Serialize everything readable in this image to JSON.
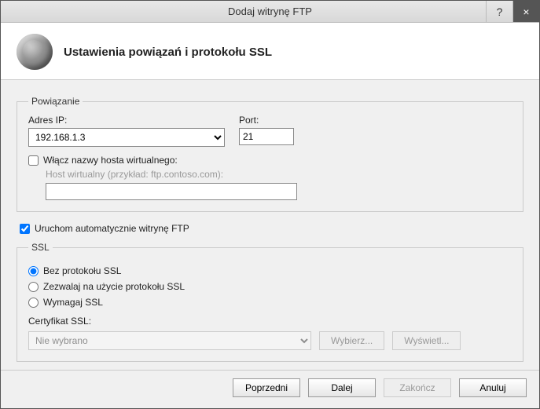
{
  "titlebar": {
    "title": "Dodaj witrynę FTP",
    "help": "?",
    "close": "×"
  },
  "header": {
    "title": "Ustawienia powiązań i protokołu SSL"
  },
  "binding": {
    "legend": "Powiązanie",
    "ip_label": "Adres IP:",
    "ip_value": "192.168.1.3",
    "port_label": "Port:",
    "port_value": "21",
    "vhost_check": "Włącz nazwy hosta wirtualnego:",
    "vhost_label": "Host wirtualny (przykład: ftp.contoso.com):",
    "vhost_value": ""
  },
  "autostart": {
    "label": "Uruchom automatycznie witrynę FTP"
  },
  "ssl": {
    "legend": "SSL",
    "opt_none": "Bez protokołu SSL",
    "opt_allow": "Zezwalaj na użycie protokołu SSL",
    "opt_require": "Wymagaj SSL",
    "cert_label": "Certyfikat SSL:",
    "cert_value": "Nie wybrano",
    "btn_select": "Wybierz...",
    "btn_view": "Wyświetl..."
  },
  "footer": {
    "prev": "Poprzedni",
    "next": "Dalej",
    "finish": "Zakończ",
    "cancel": "Anuluj"
  }
}
